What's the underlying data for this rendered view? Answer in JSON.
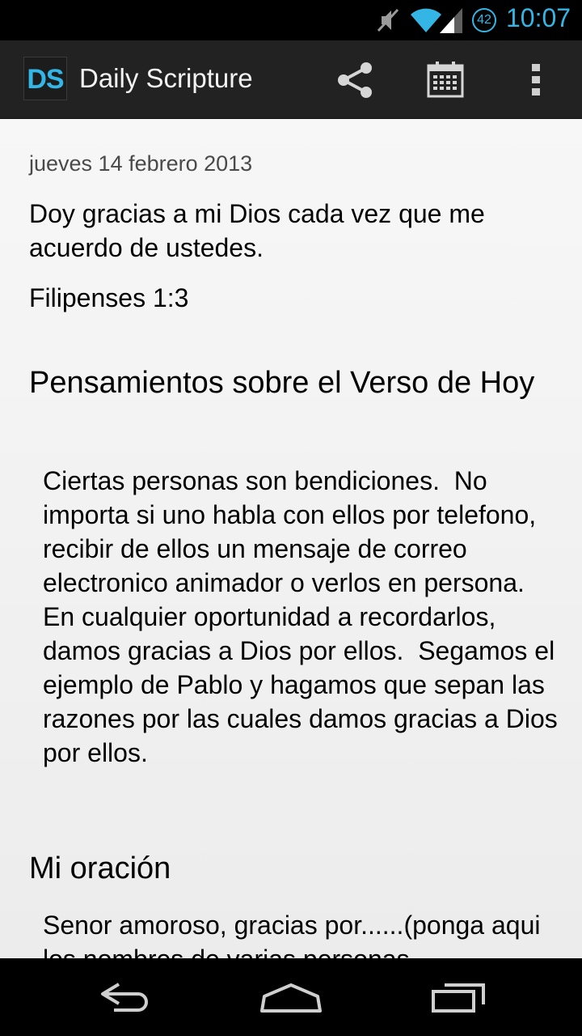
{
  "status_bar": {
    "icons": [
      "mute-icon",
      "wifi-icon",
      "signal-icon",
      "battery-icon"
    ],
    "battery_level": "42",
    "time": "10:07",
    "accent_color": "#33b5e5"
  },
  "action_bar": {
    "logo_text": "DS",
    "title": "Daily Scripture",
    "actions": [
      "share-icon",
      "calendar-icon",
      "overflow-menu-icon"
    ]
  },
  "content": {
    "date": "jueves 14 febrero 2013",
    "verse": "Doy gracias a mi Dios cada vez que me acuerdo de ustedes.",
    "reference": "Filipenses 1:3",
    "thoughts_heading": "Pensamientos sobre el Verso de Hoy",
    "thoughts_body": "Ciertas personas son bendiciones.  No importa si uno habla con ellos por telefono, recibir de ellos un mensaje de correo electronico animador o verlos en persona.  En cualquier oportunidad a recordarlos, damos gracias a Dios por ellos.  Segamos el ejemplo de Pablo y hagamos que sepan las razones por las cuales damos gracias a Dios por ellos.",
    "prayer_heading": "Mi oración",
    "prayer_body": "Senor amoroso, gracias por......(ponga aqui los nombres de varias personas"
  },
  "nav_bar": {
    "buttons": [
      "back-icon",
      "home-icon",
      "recent-apps-icon"
    ]
  }
}
